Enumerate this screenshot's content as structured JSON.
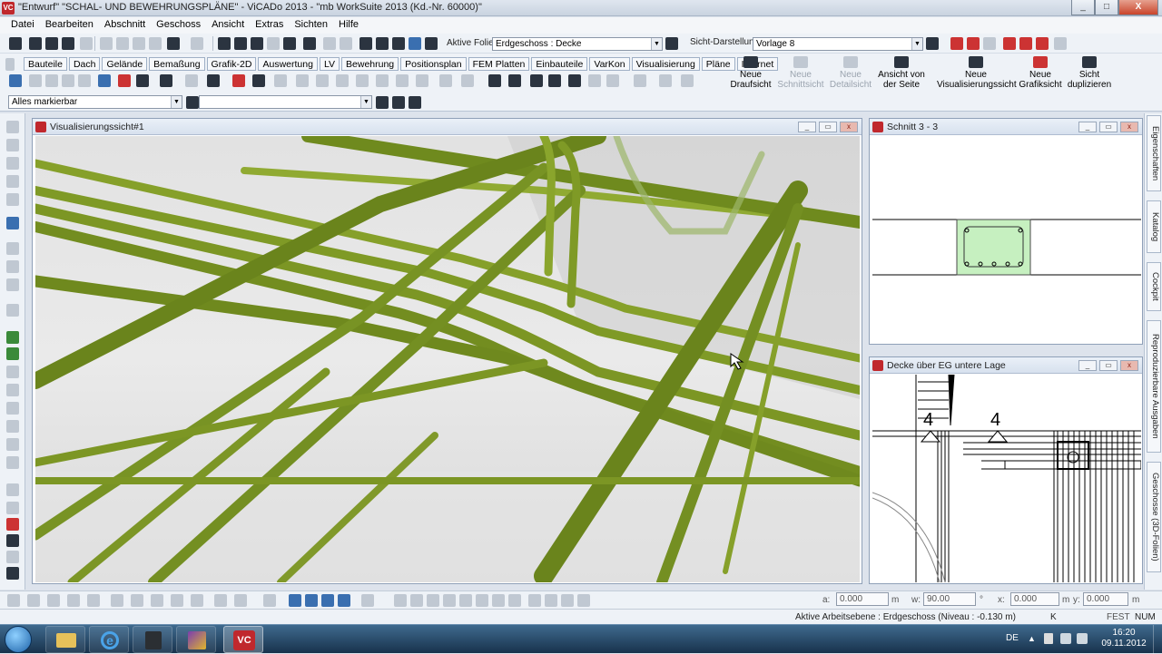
{
  "titlebar": {
    "title": "\"Entwurf\" \"SCHAL- UND BEWEHRUNGSPLÄNE\" - ViCADo 2013 - \"mb WorkSuite 2013 (Kd.-Nr. 60000)\"",
    "minimize": "_",
    "maximize": "□",
    "close": "X"
  },
  "menu": [
    "Datei",
    "Bearbeiten",
    "Abschnitt",
    "Geschoss",
    "Ansicht",
    "Extras",
    "Sichten",
    "Hilfe"
  ],
  "toolbar1": {
    "active_layer_label": "Aktive Folie:",
    "active_layer_value": "Erdgeschoss : Decke",
    "view_display_label": "Sicht-Darstellung:",
    "view_display_value": "Vorlage 8"
  },
  "ribbon_tabs": [
    "Bauteile",
    "Dach",
    "Gelände",
    "Bemaßung",
    "Grafik-2D",
    "Auswertung",
    "LV",
    "Bewehrung",
    "Positionsplan",
    "FEM Platten",
    "Einbauteile",
    "VarKon",
    "Visualisierung",
    "Pläne",
    "Internet"
  ],
  "big_buttons": [
    {
      "label1": "Neue",
      "label2": "Draufsicht",
      "enabled": true
    },
    {
      "label1": "Neue",
      "label2": "Schnittsicht",
      "enabled": false
    },
    {
      "label1": "Neue",
      "label2": "Detailsicht",
      "enabled": false
    },
    {
      "label1": "Ansicht von",
      "label2": "der Seite",
      "enabled": true
    },
    {
      "label1": "Neue",
      "label2": "Visualisierungssicht",
      "enabled": true
    },
    {
      "label1": "Neue",
      "label2": "Grafiksicht",
      "enabled": true
    },
    {
      "label1": "Sicht",
      "label2": "duplizieren",
      "enabled": true
    }
  ],
  "toolbar3": {
    "marking_value": "Alles markierbar",
    "filter_value": ""
  },
  "windows": {
    "visualisation": {
      "title": "Visualisierungssicht#1"
    },
    "section": {
      "title": "Schnitt 3 - 3"
    },
    "plan": {
      "title": "Decke über EG untere Lage",
      "label_a": "4",
      "label_b": "4"
    }
  },
  "right_dock_tabs": [
    "Eigenschaften",
    "Katalog",
    "Cockpit",
    "Reproduzierbare Ausgaben",
    "Geschosse (3D-Folien)"
  ],
  "coords": {
    "a_label": "a:",
    "a_value": "0.000",
    "a_unit": "m",
    "w_label": "w:",
    "w_value": "90.00",
    "w_unit": "°",
    "x_label": "x:",
    "x_value": "0.000",
    "x_unit": "m",
    "y_label": "y:",
    "y_value": "0.000",
    "y_unit": "m"
  },
  "status": {
    "work_plane": "Aktive Arbeitsebene : Erdgeschoss (Niveau : -0.130 m)",
    "key": "K",
    "fest": "FEST",
    "num": "NUM"
  },
  "taskbar": {
    "lang": "DE",
    "time": "16:20",
    "date": "09.11.2012"
  },
  "colors": {
    "rebar": "#8aa52c",
    "rebar_dark": "#5e7418",
    "section_fill": "#c6f0c0"
  }
}
